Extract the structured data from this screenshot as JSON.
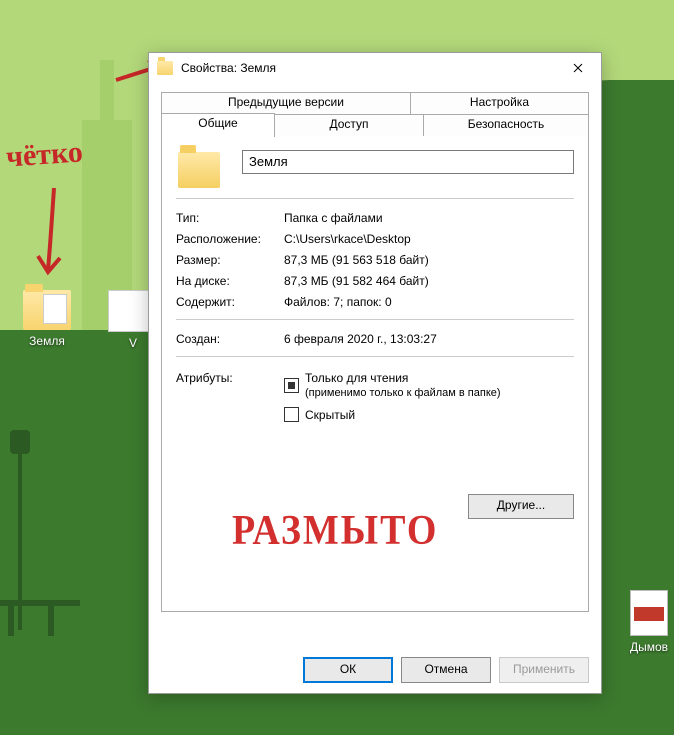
{
  "desktop": {
    "icons": {
      "folder_label": "Земля",
      "partial_label": "V",
      "pdf_label": "Дымов"
    }
  },
  "annotations": {
    "sharp": "чётко",
    "blurry": "РАЗМЫТО"
  },
  "dialog": {
    "title": "Свойства: Земля",
    "tabs": {
      "prev_versions": "Предыдущие версии",
      "customize": "Настройка",
      "general": "Общие",
      "sharing": "Доступ",
      "security": "Безопасность"
    },
    "folder_name": "Земля",
    "fields": {
      "type_label": "Тип:",
      "type_value": "Папка с файлами",
      "location_label": "Расположение:",
      "location_value": "C:\\Users\\rkace\\Desktop",
      "size_label": "Размер:",
      "size_value": "87,3 МБ (91 563 518 байт)",
      "ondisk_label": "На диске:",
      "ondisk_value": "87,3 МБ (91 582 464 байт)",
      "contains_label": "Содержит:",
      "contains_value": "Файлов: 7; папок: 0",
      "created_label": "Создан:",
      "created_value": "6 февраля 2020 г., 13:03:27",
      "attr_label": "Атрибуты:",
      "readonly": "Только для чтения",
      "readonly_note": "(применимо только к файлам в папке)",
      "hidden": "Скрытый",
      "other_btn": "Другие..."
    },
    "buttons": {
      "ok": "ОК",
      "cancel": "Отмена",
      "apply": "Применить"
    }
  }
}
